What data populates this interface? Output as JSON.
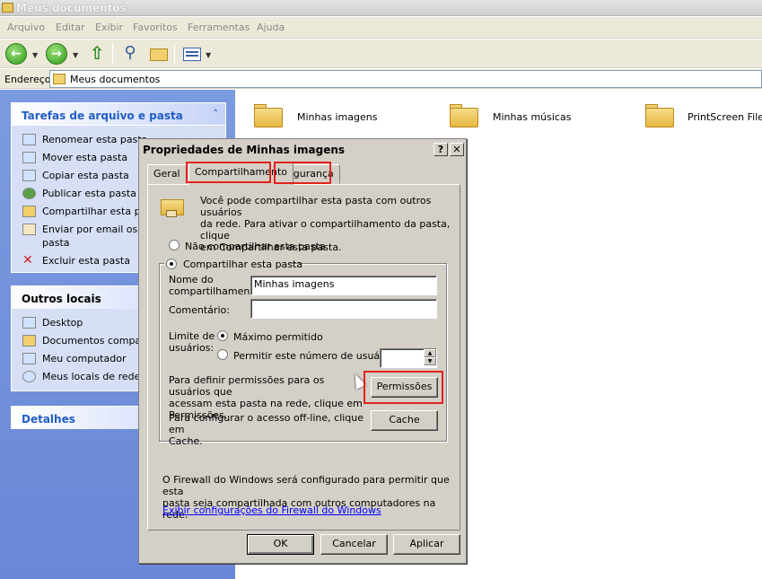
{
  "window": {
    "title": "Meus documentos"
  },
  "menu": [
    "Arquivo",
    "Editar",
    "Exibir",
    "Favoritos",
    "Ferramentas",
    "Ajuda"
  ],
  "address": {
    "label": "Endereço",
    "value": "Meus documentos"
  },
  "left_panel": {
    "tasks": {
      "title": "Tarefas de arquivo e pasta",
      "items": [
        "Renomear esta pasta",
        "Mover esta pasta",
        "Copiar esta pasta",
        "Publicar esta pasta na",
        "Compartilhar esta past",
        "Enviar por email os arc",
        "pasta",
        "Excluir esta pasta"
      ]
    },
    "other_places": {
      "title": "Outros locais",
      "items": [
        "Desktop",
        "Documentos compartil",
        "Meu computador",
        "Meus locais de rede"
      ]
    },
    "details": {
      "title": "Detalhes"
    }
  },
  "folders": [
    "Minhas imagens",
    "Minhas músicas",
    "PrintScreen Files"
  ],
  "dialog": {
    "title": "Propriedades de Minhas imagens",
    "help": "?",
    "close": "✕",
    "tabs": [
      "Geral",
      "Compartilhamento",
      "Segurança"
    ],
    "intro_line1": "Você pode compartilhar esta pasta com outros usuários",
    "intro_line2": "da rede. Para ativar o compartilhamento da pasta, clique",
    "intro_line3": "em Compartilhar esta pasta.",
    "no_share": "Não compartilhar esta pasta",
    "share": "Compartilhar esta pasta",
    "share_name_label1": "Nome do",
    "share_name_label2": "compartilhamento:",
    "share_name_value": "Minhas imagens",
    "comment_label": "Comentário:",
    "comment_value": "",
    "limit_label1": "Limite de",
    "limit_label2": "usuários:",
    "max_allowed": "Máximo permitido",
    "allow_number": "Permitir este número de usuários:",
    "perm_text1": "Para definir permissões para os usuários que",
    "perm_text2": "acessam esta pasta na rede, clique em",
    "perm_text3": "Permissões.",
    "permissions_button": "Permissões",
    "cache_text1": "Para configurar o acesso off-line, clique em",
    "cache_text2": "Cache.",
    "cache_button": "Cache",
    "firewall_line1": "O Firewall do Windows será configurado para permitir que esta",
    "firewall_line2": "pasta seja compartilhada com outros computadores na rede.",
    "firewall_link": "Exibir configurações do Firewall do Windows",
    "ok": "OK",
    "cancel": "Cancelar",
    "apply": "Aplicar"
  },
  "colors": {
    "highlight_box": "#e0231c",
    "link": "#0000ff",
    "panel_header": "#215dc6"
  }
}
